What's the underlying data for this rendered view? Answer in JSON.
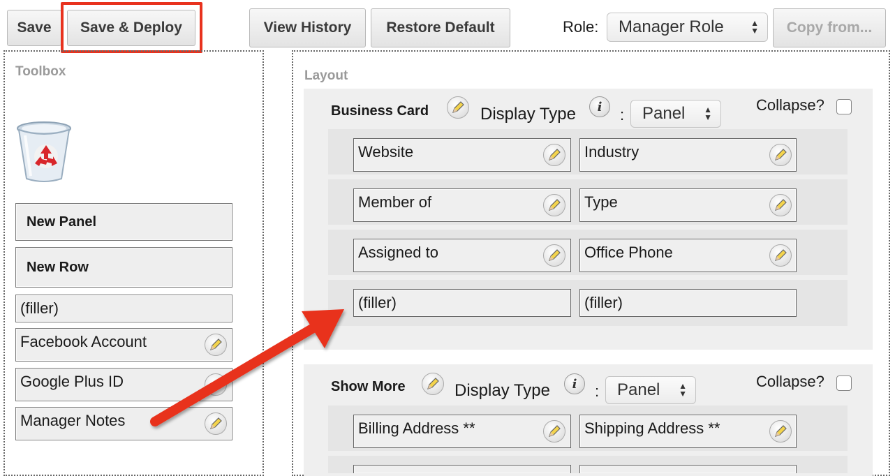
{
  "toolbar": {
    "save_label": "Save",
    "save_deploy_label": "Save & Deploy",
    "view_history_label": "View History",
    "restore_default_label": "Restore Default",
    "role_label": "Role:",
    "role_value": "Manager Role",
    "copy_from_label": "Copy from..."
  },
  "toolbox": {
    "title": "Toolbox",
    "new_panel": "New Panel",
    "new_row": "New Row",
    "filler": "(filler)",
    "fields": [
      "Facebook Account",
      "Google Plus ID",
      "Manager Notes"
    ]
  },
  "layout": {
    "title": "Layout",
    "panels": [
      {
        "name": "Business Card",
        "display_type_label": "Display Type",
        "display_type_value": "Panel",
        "collapse_label": "Collapse?",
        "rows": [
          [
            "Website",
            "Industry"
          ],
          [
            "Member of",
            "Type"
          ],
          [
            "Assigned to",
            "Office Phone"
          ],
          [
            "(filler)",
            "(filler)"
          ]
        ]
      },
      {
        "name": "Show More",
        "display_type_label": "Display Type",
        "display_type_value": "Panel",
        "collapse_label": "Collapse?",
        "rows": [
          [
            "Billing Address **",
            "Shipping Address **"
          ]
        ]
      }
    ]
  },
  "colors": {
    "highlight": "#e8321e",
    "arrow": "#e8321e"
  }
}
